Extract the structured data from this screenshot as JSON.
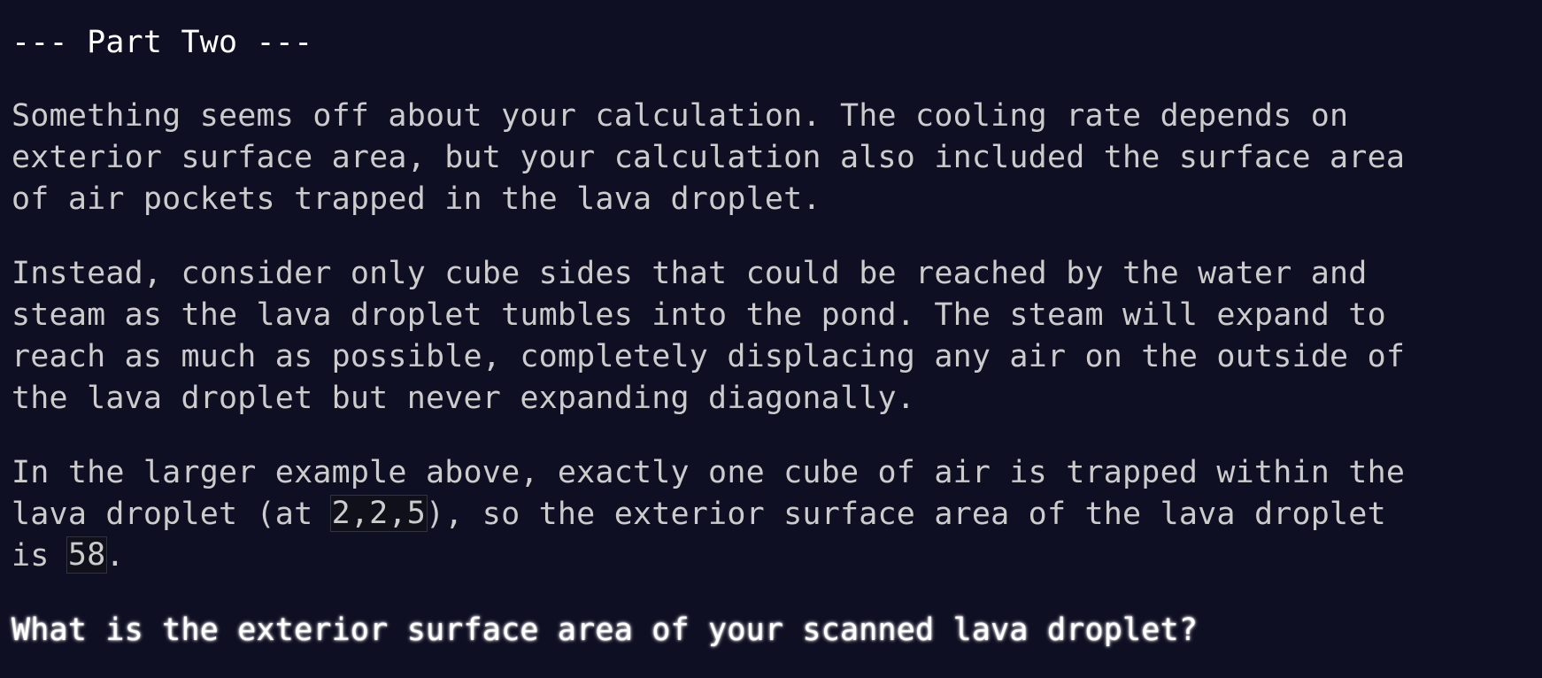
{
  "heading": "--- Part Two ---",
  "paragraph1": {
    "lines": [
      "Something seems off about your calculation. The cooling rate depends on",
      "exterior surface area, but your calculation also included the surface area",
      "of air pockets trapped in the lava droplet."
    ]
  },
  "paragraph2": {
    "lines": [
      "Instead, consider only cube sides that could be reached by the water and",
      "steam as the lava droplet tumbles into the pond. The steam will expand to",
      "reach as much as possible, completely displacing any air on the outside of",
      "the lava droplet but never expanding diagonally."
    ]
  },
  "paragraph3": {
    "line1": "In the larger example above, exactly one cube of air is trapped within the",
    "line2_before": "lava droplet (at ",
    "line2_code": "2,2,5",
    "line2_after": "), so the exterior surface area of the lava droplet",
    "line3_before": "is ",
    "line3_code": "58",
    "line3_after": "."
  },
  "question": "What is the exterior surface area of your scanned lava droplet?"
}
